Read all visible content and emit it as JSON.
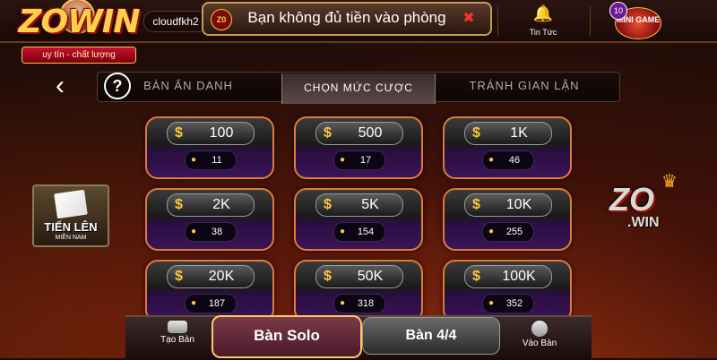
{
  "header": {
    "logo_text": "ZOWIN",
    "logo_tagline": "uy tín - chất lượng",
    "username": "cloudfkh2",
    "notice_logo": "Z0",
    "notice_text": "Bạn không đủ tiền vào phòng",
    "news_label": "Tin Tức",
    "news_icon": "bell-icon",
    "minigame_label": "MINI GAME",
    "minigame_badge": "10"
  },
  "tabs": {
    "back_icon": "chevron-left-icon",
    "help_icon": "question-icon",
    "items": [
      {
        "label": "BÀN ẨN DANH"
      },
      {
        "label": "CHỌN MỨC CƯỢC"
      },
      {
        "label": "TRÁNH GIAN LẬN"
      }
    ],
    "active": 1
  },
  "side": {
    "game_title": "TIẾN LÊN",
    "game_sub": "MIỀN NAM",
    "brand_zo": "ZO",
    "brand_win": ".WIN"
  },
  "bets": [
    {
      "amount": "100",
      "players": "11"
    },
    {
      "amount": "500",
      "players": "17"
    },
    {
      "amount": "1K",
      "players": "46"
    },
    {
      "amount": "2K",
      "players": "38"
    },
    {
      "amount": "5K",
      "players": "154"
    },
    {
      "amount": "10K",
      "players": "255"
    },
    {
      "amount": "20K",
      "players": "187"
    },
    {
      "amount": "50K",
      "players": "318"
    },
    {
      "amount": "100K",
      "players": "352"
    }
  ],
  "bet_symbols": {
    "currency": "$",
    "person": "👤"
  },
  "bottom": {
    "create_label": "Tạo Bàn",
    "solo_label": "Bàn Solo",
    "four_label": "Bàn 4/4",
    "join_label": "Vào Bàn"
  },
  "colors": {
    "accent_gold": "#ffc83a",
    "card_border": "#e07a3a",
    "notice_close": "#ff3030"
  }
}
